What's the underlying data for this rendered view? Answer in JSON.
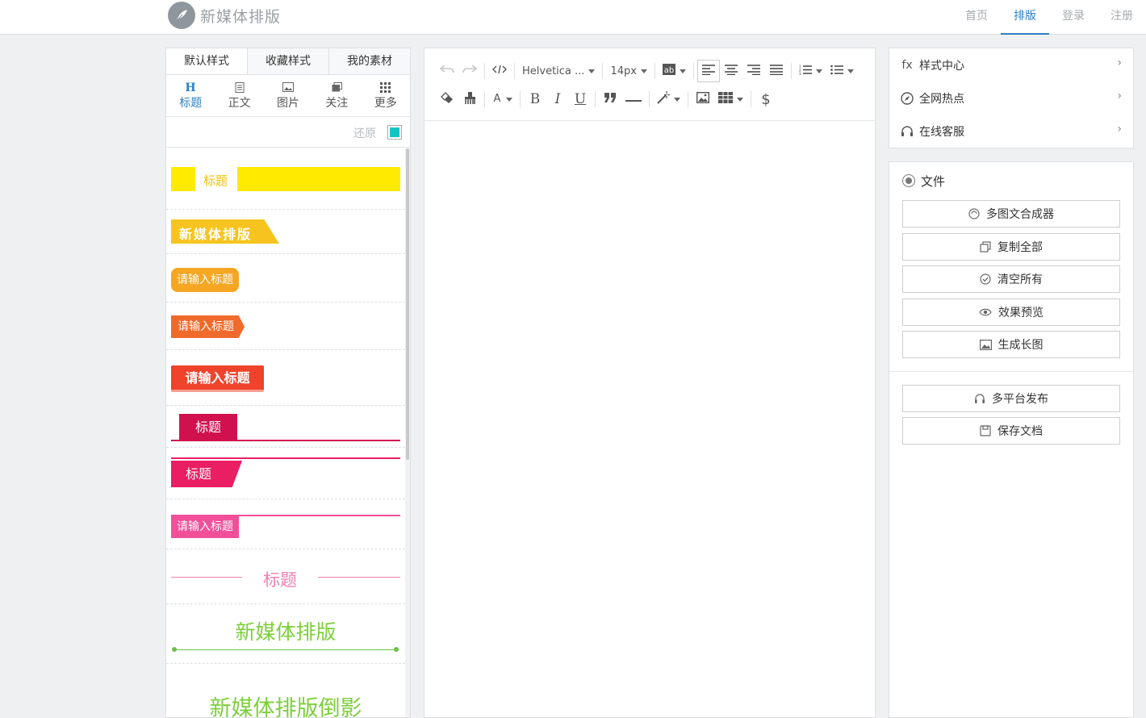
{
  "app": {
    "logo_text": "新媒体排版",
    "nav": [
      "首页",
      "排版",
      "登录",
      "注册"
    ]
  },
  "left": {
    "tabs": [
      "默认样式",
      "收藏样式",
      "我的素材"
    ],
    "categories": [
      "标题",
      "正文",
      "图片",
      "关注",
      "更多"
    ],
    "restore_label": "还原",
    "swatch_color": "#12c4c4",
    "styles": [
      "标题",
      "新媒体排版",
      "请输入标题",
      "请输入标题",
      "请输入标题",
      "标题",
      "标题",
      "请输入标题",
      "标题",
      "新媒体排版",
      "新媒体排版倒影"
    ]
  },
  "editor": {
    "font_family": "Helvetica ...",
    "font_size": "14px"
  },
  "right": {
    "menu": [
      "样式中心",
      "全网热点",
      "在线客服"
    ],
    "fx_label": "fx",
    "file_label": "文件",
    "buttons": [
      "多图文合成器",
      "复制全部",
      "清空所有",
      "效果预览",
      "生成长图"
    ],
    "buttons2": [
      "多平台发布",
      "保存文档"
    ]
  }
}
